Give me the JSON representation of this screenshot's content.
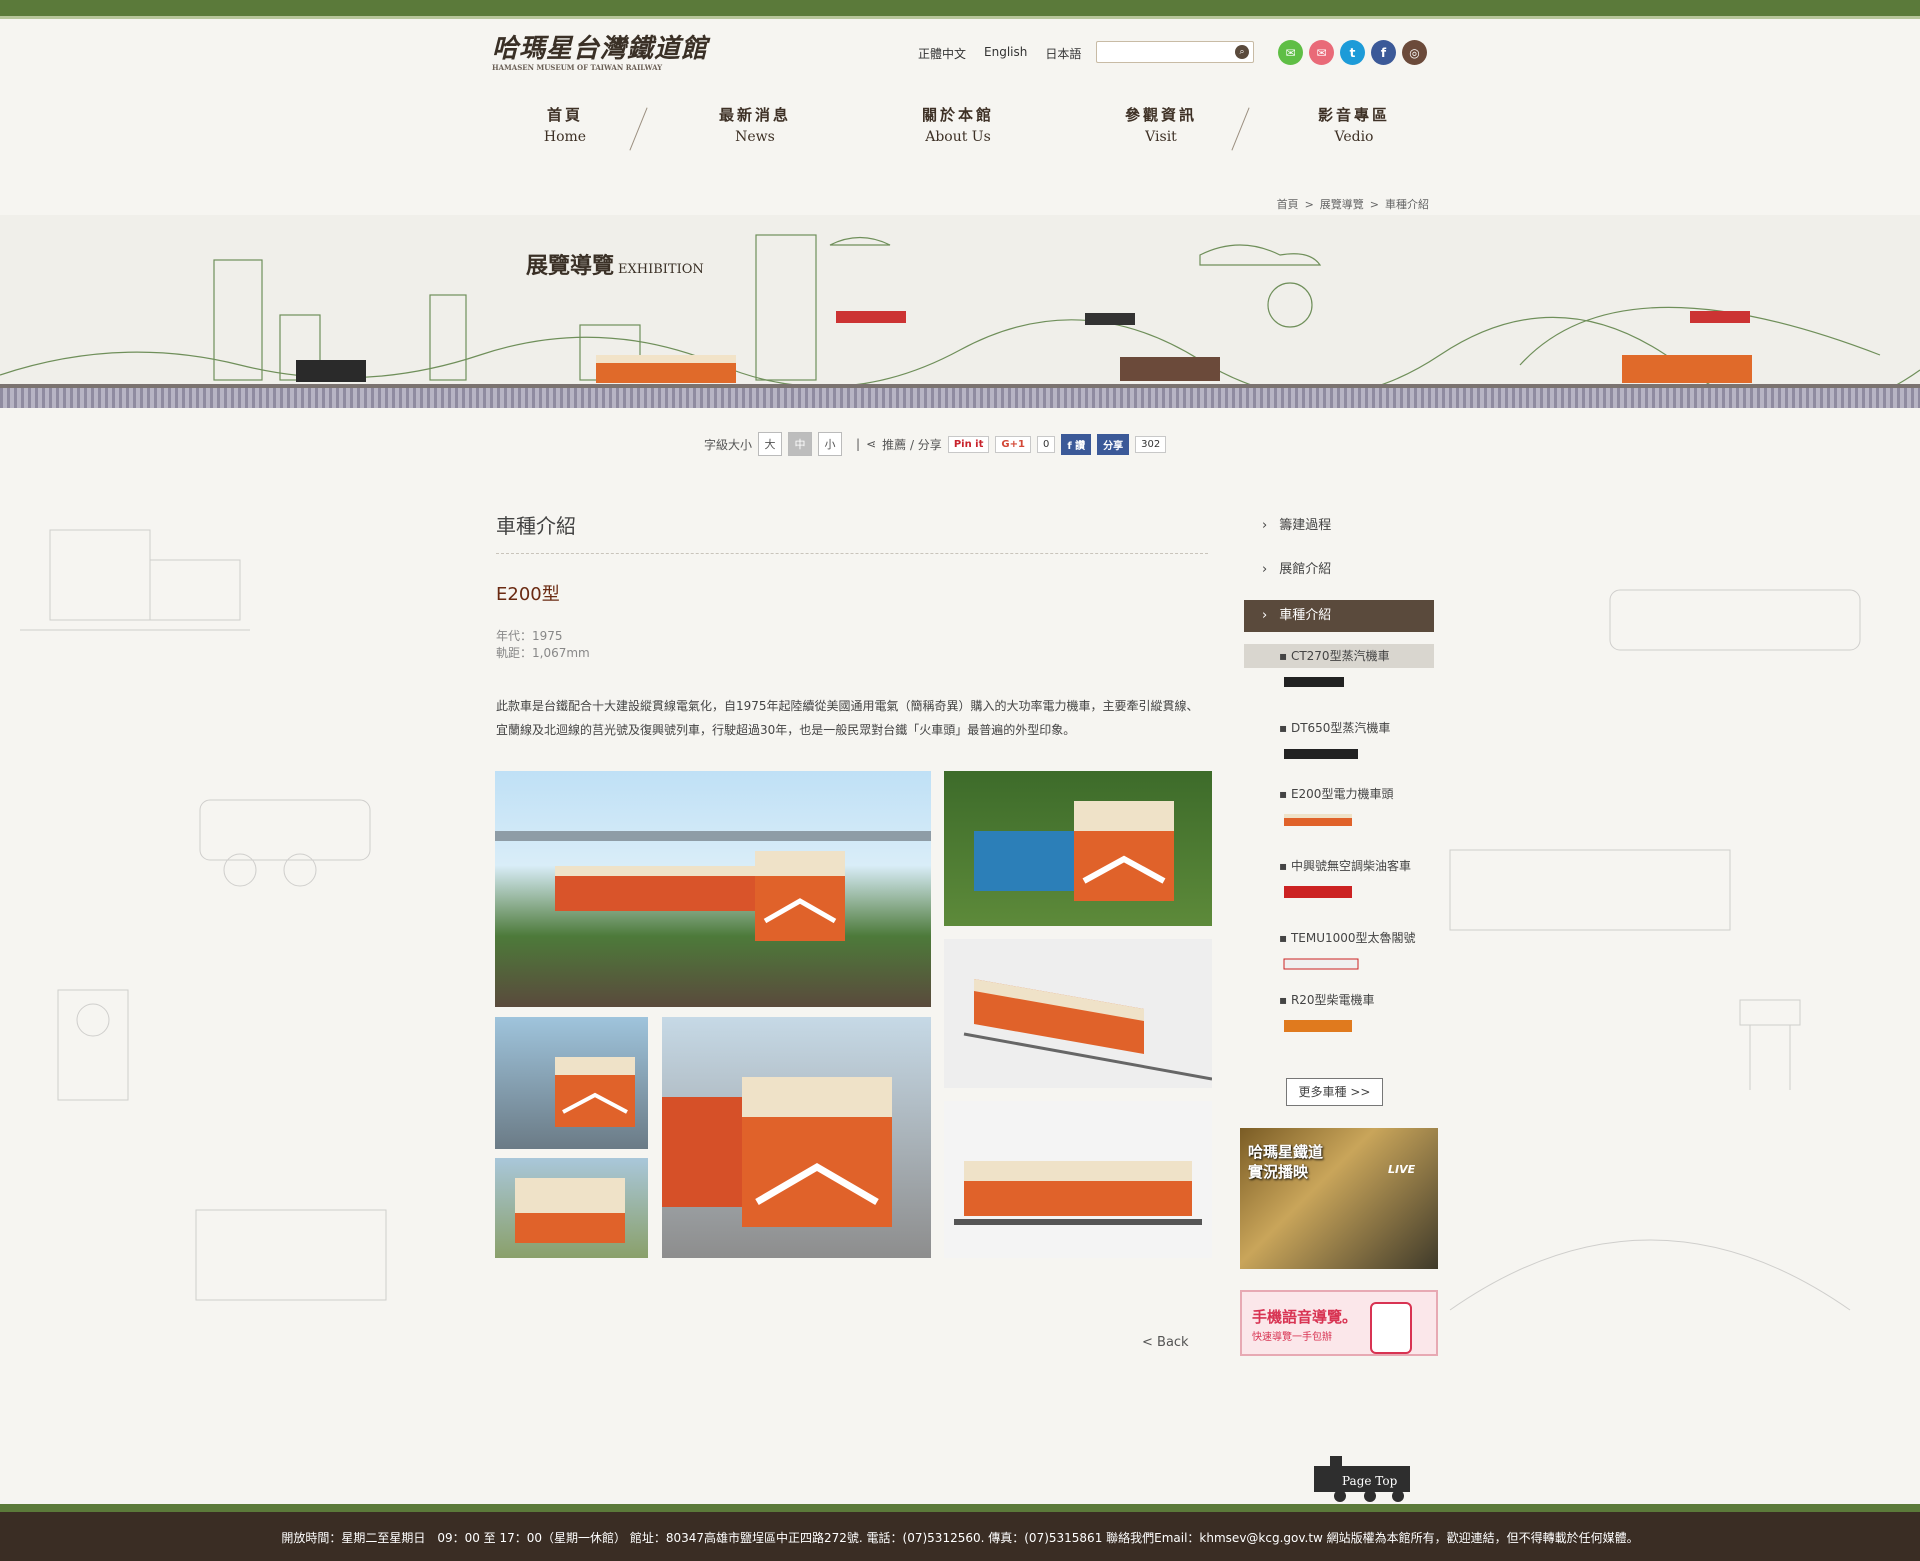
{
  "header": {
    "logo_text": "哈瑪星台灣鐵道館",
    "logo_sub": "HAMASEN MUSEUM OF TAIWAN RAILWAY",
    "langs": [
      "正體中文",
      "English",
      "日本語"
    ],
    "search_placeholder": ""
  },
  "nav": [
    {
      "zh": "首頁",
      "en": "Home"
    },
    {
      "zh": "最新消息",
      "en": "News"
    },
    {
      "zh": "關於本館",
      "en": "About Us"
    },
    {
      "zh": "參觀資訊",
      "en": "Visit"
    },
    {
      "zh": "影音專區",
      "en": "Vedio"
    }
  ],
  "breadcrumb": [
    "首頁",
    ">",
    "展覽導覽",
    ">",
    "車種介紹"
  ],
  "banner": {
    "title_zh": "展覽導覽",
    "title_en": "EXHIBITION"
  },
  "tools": {
    "font_size_label": "字級大小",
    "sizes": [
      "大",
      "中",
      "小"
    ],
    "share_label": "推薦 / 分享",
    "pinit": "Pin it",
    "gplus": "G+1",
    "gplus_count": "0",
    "fb_like": "讚",
    "fb_share": "分享",
    "fb_count": "302"
  },
  "content": {
    "title": "車種介紹",
    "model": "E200型",
    "year": "年代：1975",
    "gauge": "軌距：1,067mm",
    "desc": "此款車是台鐵配合十大建設縱貫線電氣化，自1975年起陸續從美國通用電氣（簡稱奇異）購入的大功率電力機車，主要牽引縱貫線、宜蘭線及北迴線的莒光號及復興號列車，行駛超過30年，也是一般民眾對台鐵「火車頭」最普遍的外型印象。",
    "back": "<  Back"
  },
  "sidebar": {
    "items": [
      "籌建過程",
      "展館介紹",
      "車種介紹"
    ],
    "sub_items": [
      "CT270型蒸汽機車",
      "DT650型蒸汽機車",
      "E200型電力機車頭",
      "中興號無空調柴油客車",
      "TEMU1000型太魯閣號",
      "R20型柴電機車"
    ],
    "more": "更多車種 >>",
    "live_title": "哈瑪星鐵道\n實況播映",
    "live_badge": "LIVE",
    "audio_title": "手機語音導覽。",
    "audio_sub": "快速導覽一手包辦"
  },
  "pagetop": "Page Top",
  "footer": "開放時間：星期二至星期日　09：00 至 17：00（星期一休館）  館址：80347高雄市鹽埕區中正四路272號. 電話：(07)5312560. 傳真：(07)5315861  聯絡我們Email：khmsev@kcg.gov.tw  網站版權為本館所有，歡迎連結，但不得轉載於任何媒體。",
  "colors": {
    "brand_green": "#5b7a3a",
    "brand_brown": "#5a4a3c",
    "train_orange": "#e06a2a",
    "accent_red": "#6a2a12"
  }
}
